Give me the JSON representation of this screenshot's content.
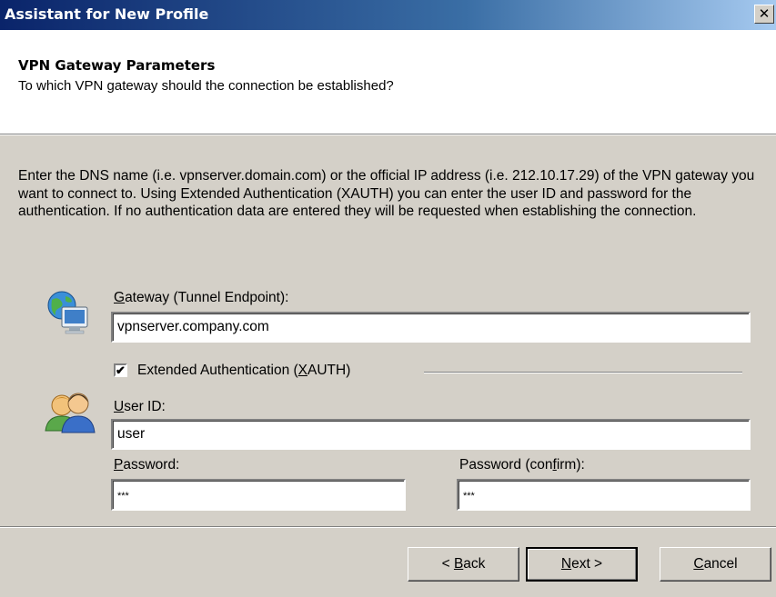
{
  "window": {
    "title": "Assistant for New Profile",
    "close_glyph": "✕"
  },
  "header": {
    "title": "VPN Gateway Parameters",
    "subtitle": "To which VPN gateway should the connection be established?"
  },
  "description": "Enter the DNS name (i.e. vpnserver.domain.com) or the official IP address (i.e. 212.10.17.29) of the VPN gateway you want to connect to. Using Extended Authentication (XAUTH) you can enter the user ID and password for the authentication. If no authentication data are entered they will be requested when establishing the connection.",
  "gateway": {
    "label_accel": "G",
    "label_rest": "ateway (Tunnel Endpoint):",
    "value": "vpnserver.company.com",
    "icon": "network-computer-icon"
  },
  "xauth": {
    "checked": true,
    "label_pre": "Extended Authentication (",
    "label_accel": "X",
    "label_post": "AUTH)",
    "icon": "users-icon"
  },
  "user_id": {
    "label_accel": "U",
    "label_rest": "ser ID:",
    "value": "user"
  },
  "password": {
    "label_accel": "P",
    "label_rest": "assword:",
    "value": "***"
  },
  "password_confirm": {
    "label_pre": "Password (con",
    "label_accel": "f",
    "label_post": "irm):",
    "value": "***"
  },
  "buttons": {
    "back_pre": "< ",
    "back_accel": "B",
    "back_post": "ack",
    "next_accel": "N",
    "next_post": "ext >",
    "cancel_accel": "C",
    "cancel_post": "ancel"
  },
  "colors": {
    "title_gradient_start": "#0a246a",
    "title_gradient_end": "#a6caf0",
    "dialog_bg": "#d4d0c8"
  }
}
